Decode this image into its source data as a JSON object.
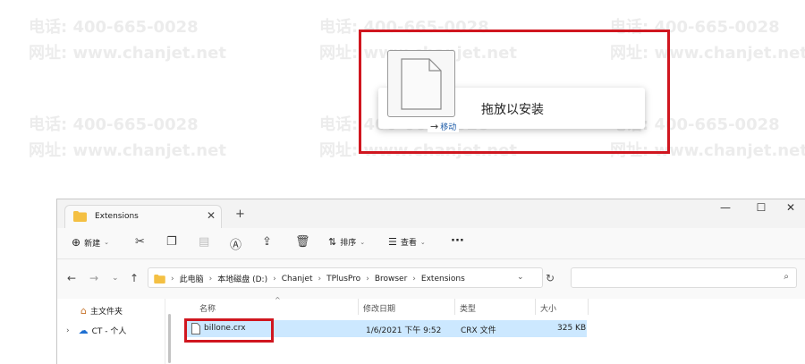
{
  "watermark": {
    "phone": "电话: 400-665-0028",
    "site": "网址: www.chanjet.net"
  },
  "drag": {
    "drop_hint": "拖放以安装",
    "move_arrow": "→",
    "move_label": "移动",
    "highlight_color": "#d0161f"
  },
  "explorer": {
    "tab": {
      "title": "Extensions",
      "close": "✕",
      "new_tab": "+"
    },
    "window_controls": {
      "minimize": "—",
      "maximize": "☐",
      "close": "✕"
    },
    "toolbar": {
      "new_label": "新建",
      "sort_label": "排序",
      "view_label": "查看",
      "more": "···"
    },
    "breadcrumb": [
      "此电脑",
      "本地磁盘 (D:)",
      "Chanjet",
      "TPlusPro",
      "Browser",
      "Extensions"
    ],
    "sidebar": {
      "home": "主文件夹",
      "onedrive": "CT - 个人"
    },
    "columns": {
      "name": "名称",
      "modified": "修改日期",
      "type": "类型",
      "size": "大小"
    },
    "files": [
      {
        "name": "billone.crx",
        "modified": "1/6/2021 下午 9:52",
        "type": "CRX 文件",
        "size": "325 KB"
      }
    ]
  }
}
